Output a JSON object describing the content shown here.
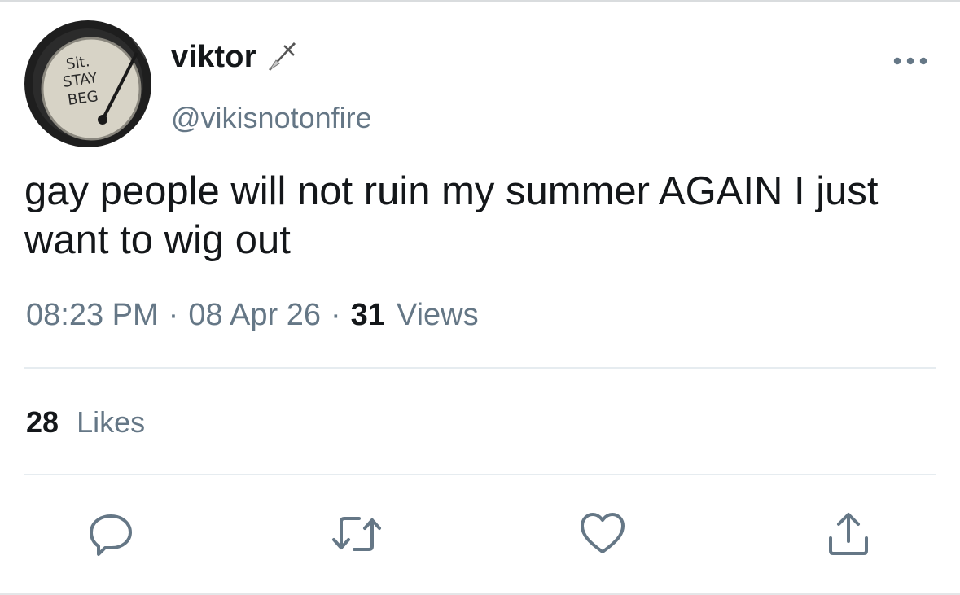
{
  "tweet": {
    "author": {
      "display_name": "viktor",
      "handle": "@vikisnotonfire",
      "name_emoji_icon": "dagger-icon",
      "avatar_text": [
        "Sit.",
        "STAY",
        "BEG"
      ]
    },
    "text": "gay people will not ruin my summer AGAIN I just want to wig out",
    "time": "08:23 PM",
    "date": "08 Apr 26",
    "separator": "·",
    "views_count": "31",
    "views_label": "Views",
    "likes_count": "28",
    "likes_label": "Likes"
  },
  "actions": {
    "more_icon": "more-icon",
    "reply_icon": "reply-icon",
    "retweet_icon": "retweet-icon",
    "like_icon": "heart-icon",
    "share_icon": "share-icon"
  },
  "colors": {
    "text_primary": "#14171a",
    "text_secondary": "#657786",
    "icon": "#657786",
    "divider": "#e6ecf0",
    "background": "#ffffff"
  }
}
